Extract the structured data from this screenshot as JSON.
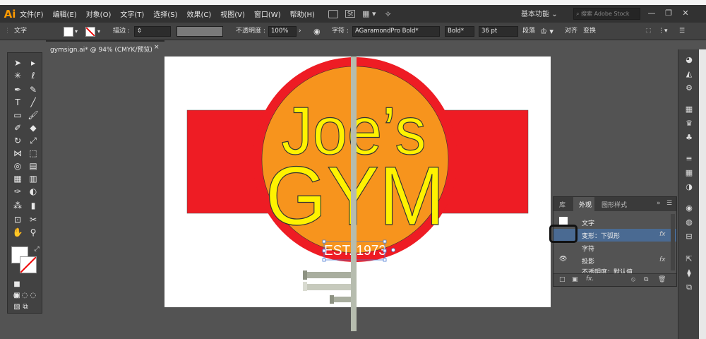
{
  "window": {
    "app_logo": "Ai"
  },
  "menu": {
    "items": [
      "文件(F)",
      "编辑(E)",
      "对象(O)",
      "文字(T)",
      "选择(S)",
      "效果(C)",
      "视图(V)",
      "窗口(W)",
      "帮助(H)"
    ],
    "st_badge": "St",
    "workspace": "基本功能",
    "search_placeholder": "搜索 Adobe Stock"
  },
  "control_bar": {
    "object_type": "文字",
    "stroke_label": "描边 :",
    "opacity_label": "不透明度 :",
    "opacity_value": "100%",
    "char_label": "字符 :",
    "font_family": "AGaramondPro Bold*",
    "font_style": "Bold*",
    "font_size": "36 pt",
    "paragraph_label": "段落",
    "align_label": "对齐",
    "transform_label": "变换"
  },
  "document": {
    "tab_title": "gymsign.ai* @ 94% (CMYK/预览)",
    "close_glyph": "×"
  },
  "artwork": {
    "line1": "Joe’s",
    "line2": "GYM",
    "est": "EST. 1973",
    "colors": {
      "red": "#ee1c24",
      "orange": "#f7941d",
      "yellow": "#fff200"
    }
  },
  "appearance_panel": {
    "tabs": [
      "库",
      "外观",
      "图形样式"
    ],
    "active_tab": "外观",
    "rows": [
      {
        "label": "文字",
        "fx": ""
      },
      {
        "label": "变形：下弧形",
        "fx": "fx"
      },
      {
        "label": "字符",
        "fx": ""
      },
      {
        "label": "投影",
        "fx": "fx"
      },
      {
        "label": "不透明度：默认值",
        "fx": ""
      }
    ]
  }
}
